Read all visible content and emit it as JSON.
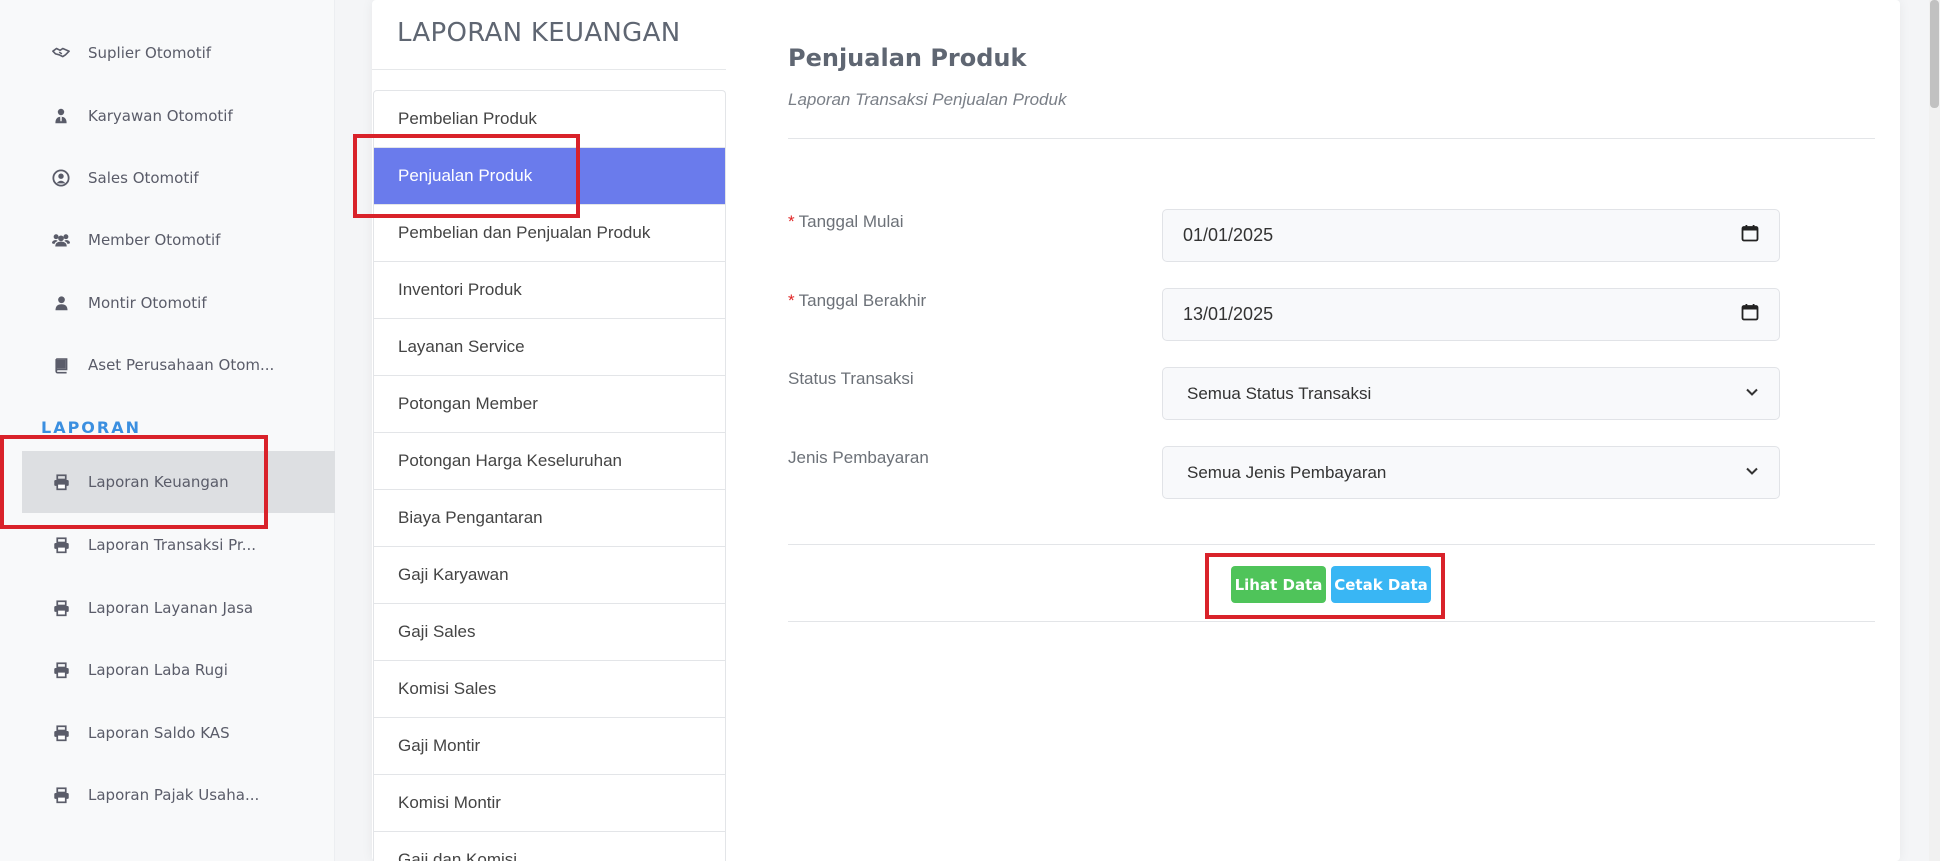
{
  "sidebar": {
    "items": [
      {
        "label": "Suplier Otomotif",
        "icon": "handshake-icon"
      },
      {
        "label": "Karyawan Otomotif",
        "icon": "user-tie-icon"
      },
      {
        "label": "Sales Otomotif",
        "icon": "user-circle-icon"
      },
      {
        "label": "Member Otomotif",
        "icon": "users-icon"
      },
      {
        "label": "Montir Otomotif",
        "icon": "user-icon"
      },
      {
        "label": "Aset Perusahaan Otom...",
        "icon": "book-icon"
      }
    ],
    "heading": "LAPORAN",
    "reports": [
      {
        "label": "Laporan Keuangan",
        "icon": "print-icon",
        "active": true
      },
      {
        "label": "Laporan Transaksi Pr...",
        "icon": "print-icon"
      },
      {
        "label": "Laporan Layanan Jasa",
        "icon": "print-icon"
      },
      {
        "label": "Laporan Laba Rugi",
        "icon": "print-icon"
      },
      {
        "label": "Laporan Saldo KAS",
        "icon": "print-icon"
      },
      {
        "label": "Laporan Pajak Usaha...",
        "icon": "print-icon"
      }
    ]
  },
  "card": {
    "title": "LAPORAN KEUANGAN"
  },
  "menu": {
    "items": [
      "Pembelian Produk",
      "Penjualan Produk",
      "Pembelian dan Penjualan Produk",
      "Inventori Produk",
      "Layanan Service",
      "Potongan Member",
      "Potongan Harga Keseluruhan",
      "Biaya Pengantaran",
      "Gaji Karyawan",
      "Gaji Sales",
      "Komisi Sales",
      "Gaji Montir",
      "Komisi Montir",
      "Gaji dan Komisi"
    ],
    "active_index": 1
  },
  "form": {
    "title": "Penjualan Produk",
    "subtitle": "Laporan Transaksi Penjualan Produk",
    "required_mark": "*",
    "start_label": "Tanggal Mulai",
    "start_value": "01/01/2025",
    "end_label": "Tanggal Berakhir",
    "end_value": "13/01/2025",
    "status_label": "Status Transaksi",
    "status_value": "Semua Status Transaksi",
    "payment_label": "Jenis Pembayaran",
    "payment_value": "Semua Jenis Pembayaran",
    "view_button": "Lihat Data",
    "print_button": "Cetak Data"
  },
  "colors": {
    "active_menu": "#6a7bec",
    "view_button": "#4fc45a",
    "print_button": "#39b6f4",
    "section_heading": "#3b8fe0",
    "annotation": "#d9222a"
  }
}
